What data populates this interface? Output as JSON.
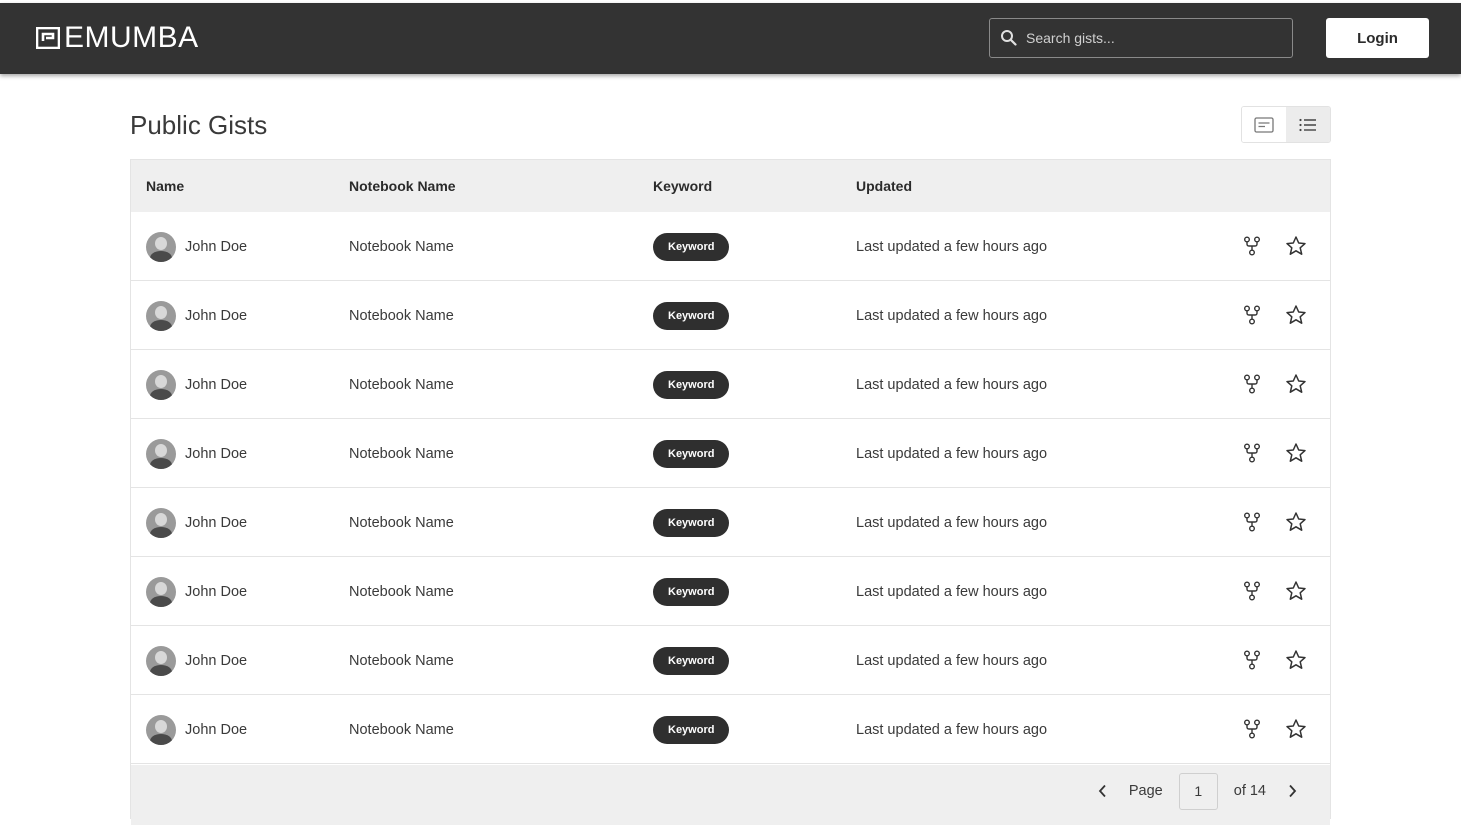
{
  "header": {
    "brand": "EMUMBA",
    "search": {
      "placeholder": "Search gists...",
      "value": ""
    },
    "login_label": "Login"
  },
  "page": {
    "title": "Public Gists",
    "view_toggle": {
      "active": "list"
    }
  },
  "table": {
    "columns": [
      "Name",
      "Notebook Name",
      "Keyword",
      "Updated"
    ],
    "rows": [
      {
        "name": "John Doe",
        "notebook": "Notebook Name",
        "keyword": "Keyword",
        "updated": "Last updated a few hours ago"
      },
      {
        "name": "John Doe",
        "notebook": "Notebook Name",
        "keyword": "Keyword",
        "updated": "Last updated a few hours ago"
      },
      {
        "name": "John Doe",
        "notebook": "Notebook Name",
        "keyword": "Keyword",
        "updated": "Last updated a few hours ago"
      },
      {
        "name": "John Doe",
        "notebook": "Notebook Name",
        "keyword": "Keyword",
        "updated": "Last updated a few hours ago"
      },
      {
        "name": "John Doe",
        "notebook": "Notebook Name",
        "keyword": "Keyword",
        "updated": "Last updated a few hours ago"
      },
      {
        "name": "John Doe",
        "notebook": "Notebook Name",
        "keyword": "Keyword",
        "updated": "Last updated a few hours ago"
      },
      {
        "name": "John Doe",
        "notebook": "Notebook Name",
        "keyword": "Keyword",
        "updated": "Last updated a few hours ago"
      },
      {
        "name": "John Doe",
        "notebook": "Notebook Name",
        "keyword": "Keyword",
        "updated": "Last updated a few hours ago"
      }
    ]
  },
  "pagination": {
    "page_label": "Page",
    "current_page": "1",
    "of_label": "of 14"
  },
  "colors": {
    "header_bg": "#333333",
    "badge_bg": "#2f2f2f",
    "table_header_bg": "#efefef"
  },
  "icons": {
    "search": "search-icon",
    "card_view": "card-view-icon",
    "list_view": "list-view-icon",
    "fork": "fork-icon",
    "star": "star-icon",
    "prev": "chevron-left-icon",
    "next": "chevron-right-icon"
  }
}
